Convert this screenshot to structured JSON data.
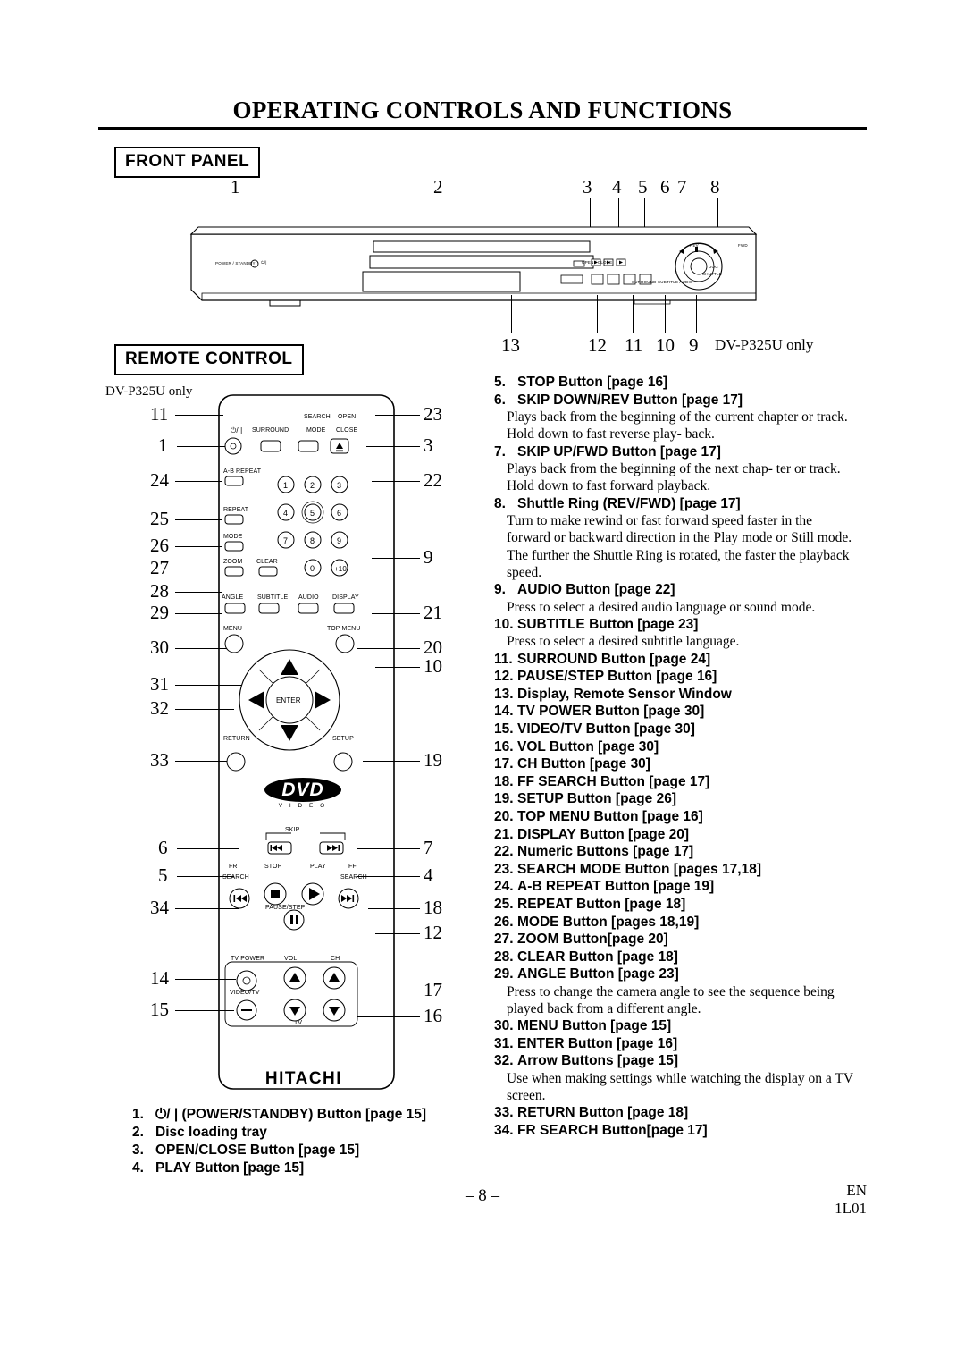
{
  "page": {
    "title": "OPERATING CONTROLS AND FUNCTIONS",
    "footer_page": "– 8 –",
    "footer_en": "EN",
    "footer_code": "1L01"
  },
  "sections": {
    "front_panel": "FRONT PANEL",
    "remote_control": "REMOTE CONTROL"
  },
  "notes": {
    "front_panel_model": "DV-P325U only",
    "remote_model": "DV-P325U only",
    "brand": "HITACHI",
    "dvd_logo": "DVD",
    "dvd_logo_sub": "V I D E O"
  },
  "front_panel": {
    "callouts": [
      "1",
      "2",
      "3",
      "4",
      "5",
      "6",
      "7",
      "8",
      "13",
      "12",
      "11",
      "10",
      "9"
    ],
    "labels": {
      "power": "POWER / STANDBY",
      "power_sym": "⏻/|",
      "open_close": "OPEN / CLOSE",
      "rev": "REV",
      "fwd": "FWD",
      "jog": "JOG",
      "shuttle": "SHUTTLE",
      "bottom_row": "SURROUND  SUBTITLE  AUDIO"
    }
  },
  "remote": {
    "callouts_left": [
      "11",
      "1",
      "24",
      "25",
      "26",
      "27",
      "28",
      "29",
      "30",
      "31",
      "32",
      "33",
      "6",
      "5",
      "34",
      "14",
      "15"
    ],
    "callouts_right": [
      "23",
      "3",
      "22",
      "9",
      "21",
      "20",
      "10",
      "19",
      "7",
      "4",
      "18",
      "12",
      "17",
      "16"
    ],
    "buttons": {
      "power": "⏻/ |",
      "surround": "SURROUND",
      "search_mode": "SEARCH\nMODE",
      "search_mode_l1": "SEARCH",
      "search_mode_l2": "MODE",
      "open_close_l1": "OPEN",
      "open_close_l2": "CLOSE",
      "ab_repeat": "A-B REPEAT",
      "repeat": "REPEAT",
      "mode": "MODE",
      "zoom": "ZOOM",
      "clear": "CLEAR",
      "angle": "ANGLE",
      "subtitle": "SUBTITLE",
      "audio": "AUDIO",
      "display": "DISPLAY",
      "menu": "MENU",
      "top_menu": "TOP MENU",
      "enter": "ENTER",
      "return": "RETURN",
      "setup": "SETUP",
      "skip": "SKIP",
      "stop": "STOP",
      "play": "PLAY",
      "fr_search_l1": "FR",
      "fr_search_l2": "SEARCH",
      "ff_search_l1": "FF",
      "ff_search_l2": "SEARCH",
      "pause_step": "PAUSE/STEP",
      "tv_power": "TV POWER",
      "vol": "VOL",
      "ch": "CH",
      "video_tv": "VIDEO/TV",
      "tv": "TV",
      "numeric": [
        "1",
        "2",
        "3",
        "4",
        "5",
        "6",
        "7",
        "8",
        "9",
        "0",
        "+10"
      ]
    }
  },
  "descriptions_right": [
    {
      "num": "5.",
      "title": "STOP Button [page 16]",
      "body": ""
    },
    {
      "num": "6.",
      "title": "SKIP DOWN/REV Button [page 17]",
      "body": "Plays back from the beginning of the current chapter or track. Hold down to fast reverse play- back."
    },
    {
      "num": "7.",
      "title": "SKIP UP/FWD Button [page 17]",
      "body": "Plays back from the beginning of the next chap- ter or track. Hold down to fast forward playback."
    },
    {
      "num": "8.",
      "title": "Shuttle Ring (REV/FWD) [page 17]",
      "body": "Turn to make rewind or fast forward speed faster in the forward or backward direction in the Play mode or Still mode. The further the Shuttle Ring is rotated, the faster the playback speed."
    },
    {
      "num": "9.",
      "title": "AUDIO Button [page 22]",
      "body": "Press to select a desired audio language or sound mode."
    },
    {
      "num": "10.",
      "title": "SUBTITLE Button [page 23]",
      "body": "Press to select a desired subtitle language."
    },
    {
      "num": "11.",
      "title": "SURROUND Button [page 24]",
      "body": ""
    },
    {
      "num": "12.",
      "title": "PAUSE/STEP Button [page 16]",
      "body": ""
    },
    {
      "num": "13.",
      "title": "Display, Remote Sensor Window",
      "body": ""
    },
    {
      "num": "14.",
      "title": "TV POWER Button [page 30]",
      "body": ""
    },
    {
      "num": "15.",
      "title": "VIDEO/TV Button [page 30]",
      "body": ""
    },
    {
      "num": "16.",
      "title": "VOL Button [page 30]",
      "body": ""
    },
    {
      "num": "17.",
      "title": "CH Button [page 30]",
      "body": ""
    },
    {
      "num": "18.",
      "title": "FF SEARCH Button [page 17]",
      "body": ""
    },
    {
      "num": "19.",
      "title": "SETUP Button [page 26]",
      "body": ""
    },
    {
      "num": "20.",
      "title": "TOP MENU Button [page 16]",
      "body": ""
    },
    {
      "num": "21.",
      "title": "DISPLAY Button [page 20]",
      "body": ""
    },
    {
      "num": "22.",
      "title": "Numeric Buttons [page 17]",
      "body": ""
    },
    {
      "num": "23.",
      "title": "SEARCH MODE Button [pages 17,18]",
      "body": ""
    },
    {
      "num": "24.",
      "title": "A-B REPEAT Button [page 19]",
      "body": ""
    },
    {
      "num": "25.",
      "title": "REPEAT Button [page 18]",
      "body": ""
    },
    {
      "num": "26.",
      "title": "MODE Button [pages 18,19]",
      "body": ""
    },
    {
      "num": "27.",
      "title": "ZOOM Button[page 20]",
      "body": ""
    },
    {
      "num": "28.",
      "title": "CLEAR Button [page 18]",
      "body": ""
    },
    {
      "num": "29.",
      "title": "ANGLE Button [page 23]",
      "body": "Press to change the camera angle to see the sequence being played back from a different angle."
    },
    {
      "num": "30.",
      "title": "MENU Button [page 15]",
      "body": ""
    },
    {
      "num": "31.",
      "title": "ENTER Button [page 16]",
      "body": ""
    },
    {
      "num": "32.",
      "title": "Arrow Buttons [page 15]",
      "body": "Use when making settings while watching the display on a TV screen."
    },
    {
      "num": "33.",
      "title": "RETURN Button [page 18]",
      "body": ""
    },
    {
      "num": "34.",
      "title": "FR SEARCH Button[page 17]",
      "body": ""
    }
  ],
  "descriptions_bottom": [
    {
      "num": "1.",
      "title": "⏻/ | (POWER/STANDBY) Button [page 15]"
    },
    {
      "num": "2.",
      "title": "Disc loading tray"
    },
    {
      "num": "3.",
      "title": "OPEN/CLOSE Button [page 15]"
    },
    {
      "num": "4.",
      "title": "PLAY Button [page 15]"
    }
  ]
}
